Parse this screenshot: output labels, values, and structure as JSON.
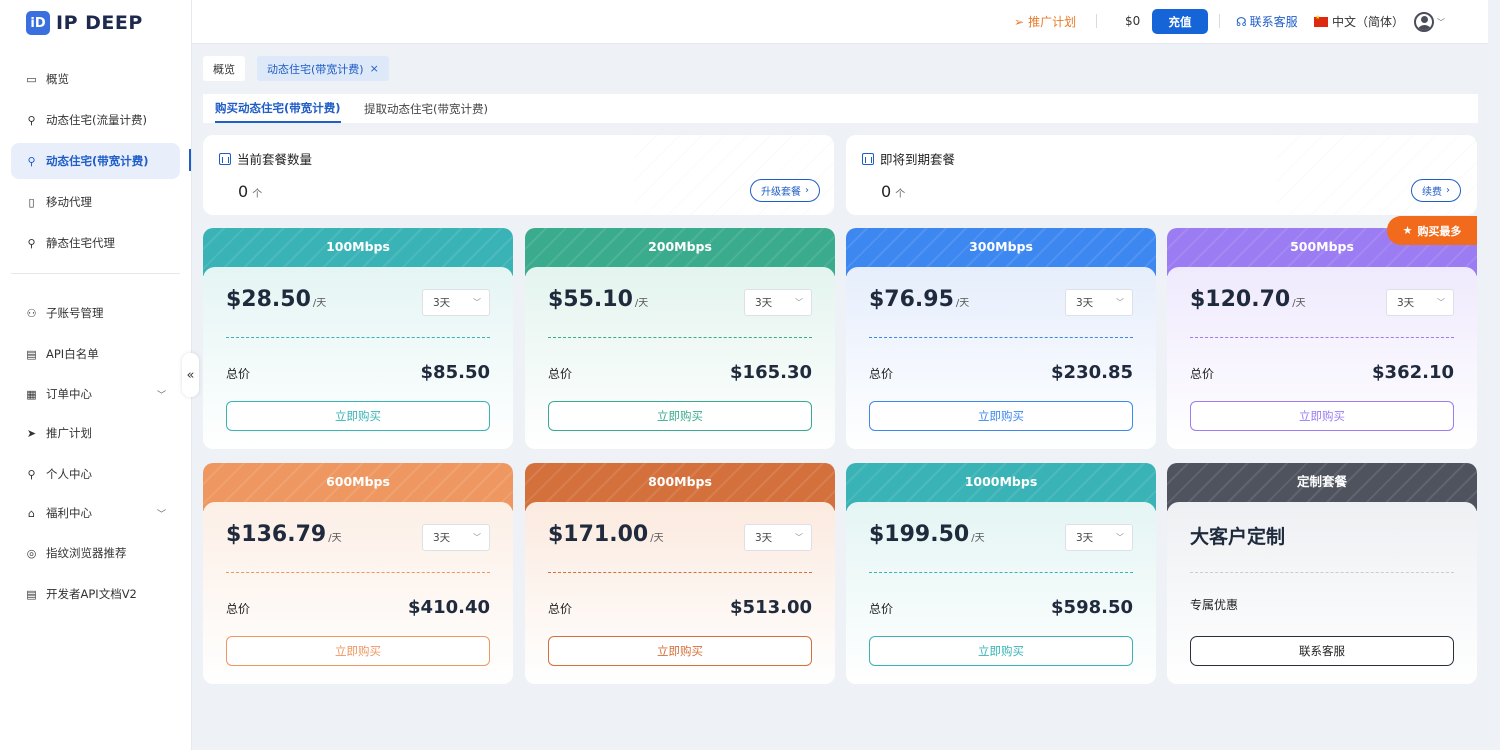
{
  "brand": {
    "logo_mark": "iD",
    "name": "IP DEEP"
  },
  "sidebar": {
    "items": [
      {
        "label": "概览",
        "icon": "overview-icon"
      },
      {
        "label": "动态住宅(流量计费)",
        "icon": "location-pin-icon"
      },
      {
        "label": "动态住宅(带宽计费)",
        "icon": "location-pin-icon",
        "active": true
      },
      {
        "label": "移动代理",
        "icon": "mobile-icon"
      },
      {
        "label": "静态住宅代理",
        "icon": "location-pin-icon"
      },
      {
        "label": "子账号管理",
        "icon": "users-icon"
      },
      {
        "label": "API白名单",
        "icon": "document-icon"
      },
      {
        "label": "订单中心",
        "icon": "clipboard-icon",
        "expandable": true
      },
      {
        "label": "推广计划",
        "icon": "send-icon"
      },
      {
        "label": "个人中心",
        "icon": "user-icon"
      },
      {
        "label": "福利中心",
        "icon": "gift-icon",
        "expandable": true
      },
      {
        "label": "指纹浏览器推荐",
        "icon": "fingerprint-icon"
      },
      {
        "label": "开发者API文档V2",
        "icon": "file-icon"
      }
    ],
    "collapse_glyph": "«"
  },
  "header": {
    "promo": "推广计划",
    "balance": "$0",
    "recharge": "充值",
    "service": "联系客服",
    "language": "中文（简体）"
  },
  "tabs": {
    "overview": "概览",
    "current": "动态住宅(带宽计费)",
    "close": "×"
  },
  "subtabs": [
    "购买动态住宅(带宽计费)",
    "提取动态住宅(带宽计费)"
  ],
  "stats": [
    {
      "title": "当前套餐数量",
      "value": "0",
      "unit": "个",
      "button": "升级套餐"
    },
    {
      "title": "即将到期套餐",
      "value": "0",
      "unit": "个",
      "button": "续费"
    }
  ],
  "plans": [
    {
      "name": "100Mbps",
      "price": "$28.50",
      "per": "/天",
      "duration": "3天",
      "total_label": "总价",
      "total": "$85.50",
      "buy": "立即购买"
    },
    {
      "name": "200Mbps",
      "price": "$55.10",
      "per": "/天",
      "duration": "3天",
      "total_label": "总价",
      "total": "$165.30",
      "buy": "立即购买"
    },
    {
      "name": "300Mbps",
      "price": "$76.95",
      "per": "/天",
      "duration": "3天",
      "total_label": "总价",
      "total": "$230.85",
      "buy": "立即购买"
    },
    {
      "name": "500Mbps",
      "price": "$120.70",
      "per": "/天",
      "duration": "3天",
      "total_label": "总价",
      "total": "$362.10",
      "buy": "立即购买",
      "badge": "购买最多"
    },
    {
      "name": "600Mbps",
      "price": "$136.79",
      "per": "/天",
      "duration": "3天",
      "total_label": "总价",
      "total": "$410.40",
      "buy": "立即购买"
    },
    {
      "name": "800Mbps",
      "price": "$171.00",
      "per": "/天",
      "duration": "3天",
      "total_label": "总价",
      "total": "$513.00",
      "buy": "立即购买"
    },
    {
      "name": "1000Mbps",
      "price": "$199.50",
      "per": "/天",
      "duration": "3天",
      "total_label": "总价",
      "total": "$598.50",
      "buy": "立即购买"
    }
  ],
  "custom_plan": {
    "name": "定制套餐",
    "title": "大客户定制",
    "subtitle": "专属优惠",
    "button": "联系客服"
  },
  "colors": {
    "primary": "#1565d8",
    "accent_orange": "#f26b1d",
    "plan_100": "#39b3b6",
    "plan_200": "#3aab8c",
    "plan_300": "#3d87f0",
    "plan_500": "#9b7cf2",
    "plan_600": "#ee9760",
    "plan_800": "#d4703b",
    "plan_1000": "#39b3b6",
    "plan_custom": "#4e535d"
  }
}
